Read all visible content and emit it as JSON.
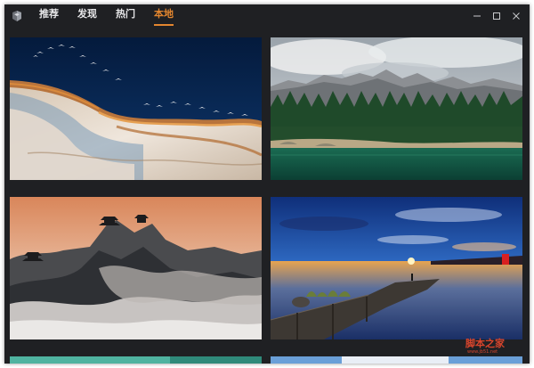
{
  "tabs": [
    {
      "label": "推荐",
      "active": false
    },
    {
      "label": "发现",
      "active": false
    },
    {
      "label": "热门",
      "active": false
    },
    {
      "label": "本地",
      "active": true
    }
  ],
  "window_controls": {
    "minimize_icon": "minimize-icon",
    "maximize_icon": "maximize-icon",
    "close_icon": "close-icon"
  },
  "accent_color": "#e3862f",
  "watermark": {
    "main": "脚本之家",
    "sub": "www.jb51.net"
  }
}
